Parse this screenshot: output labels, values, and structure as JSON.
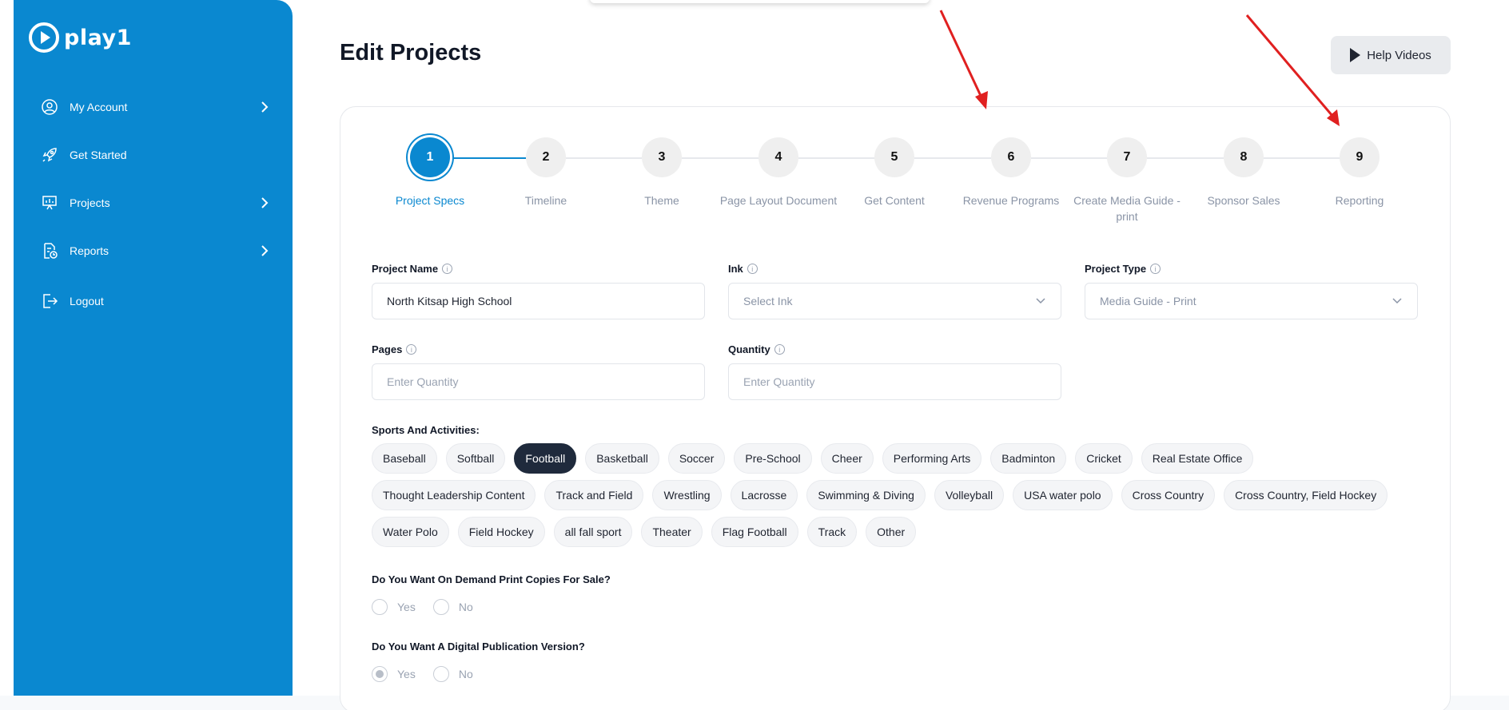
{
  "app": {
    "logo_text": "play1"
  },
  "sidebar": {
    "items": [
      {
        "label": "My Account",
        "icon": "user-circle-icon",
        "has_chevron": true
      },
      {
        "label": "Get Started",
        "icon": "rocket-icon",
        "has_chevron": false
      },
      {
        "label": "Projects",
        "icon": "presentation-icon",
        "has_chevron": true
      },
      {
        "label": "Reports",
        "icon": "report-icon",
        "has_chevron": true
      },
      {
        "label": "Logout",
        "icon": "logout-icon",
        "has_chevron": false
      }
    ]
  },
  "header": {
    "title": "Edit Projects",
    "help_label": "Help Videos"
  },
  "stepper": {
    "active": 1,
    "steps": [
      {
        "num": "1",
        "label": "Project Specs"
      },
      {
        "num": "2",
        "label": "Timeline"
      },
      {
        "num": "3",
        "label": "Theme"
      },
      {
        "num": "4",
        "label": "Page Layout Document"
      },
      {
        "num": "5",
        "label": "Get Content"
      },
      {
        "num": "6",
        "label": "Revenue Programs"
      },
      {
        "num": "7",
        "label": "Create Media Guide - print"
      },
      {
        "num": "8",
        "label": "Sponsor Sales"
      },
      {
        "num": "9",
        "label": "Reporting"
      }
    ]
  },
  "form": {
    "project_name": {
      "label": "Project Name",
      "value": "North Kitsap High School"
    },
    "ink": {
      "label": "Ink",
      "placeholder": "Select Ink"
    },
    "project_type": {
      "label": "Project Type",
      "value": "Media Guide - Print"
    },
    "pages": {
      "label": "Pages",
      "placeholder": "Enter Quantity"
    },
    "quantity": {
      "label": "Quantity",
      "placeholder": "Enter Quantity"
    },
    "sports_label": "Sports And Activities:",
    "sports_rows": [
      [
        "Baseball",
        "Softball",
        "Football",
        "Basketball",
        "Soccer",
        "Pre-School",
        "Cheer",
        "Performing Arts",
        "Badminton",
        "Cricket",
        "Real Estate Office"
      ],
      [
        "Thought Leadership Content",
        "Track and Field",
        "Wrestling",
        "Lacrosse",
        "Swimming & Diving",
        "Volleyball",
        "USA water polo",
        "Cross Country",
        "Cross Country, Field Hockey"
      ],
      [
        "Water Polo",
        "Field Hockey",
        "all fall sport",
        "Theater",
        "Flag Football",
        "Track",
        "Other"
      ]
    ],
    "selected_sport": "Football",
    "q_print": {
      "label": "Do You Want On Demand Print Copies For Sale?",
      "yes": "Yes",
      "no": "No",
      "selected": ""
    },
    "q_digital": {
      "label": "Do You Want A Digital Publication Version?",
      "yes": "Yes",
      "no": "No",
      "selected": "Yes"
    }
  },
  "colors": {
    "brand": "#0a88d0",
    "chip_selected": "#1f2a3c",
    "annotation_arrow": "#e02020"
  }
}
